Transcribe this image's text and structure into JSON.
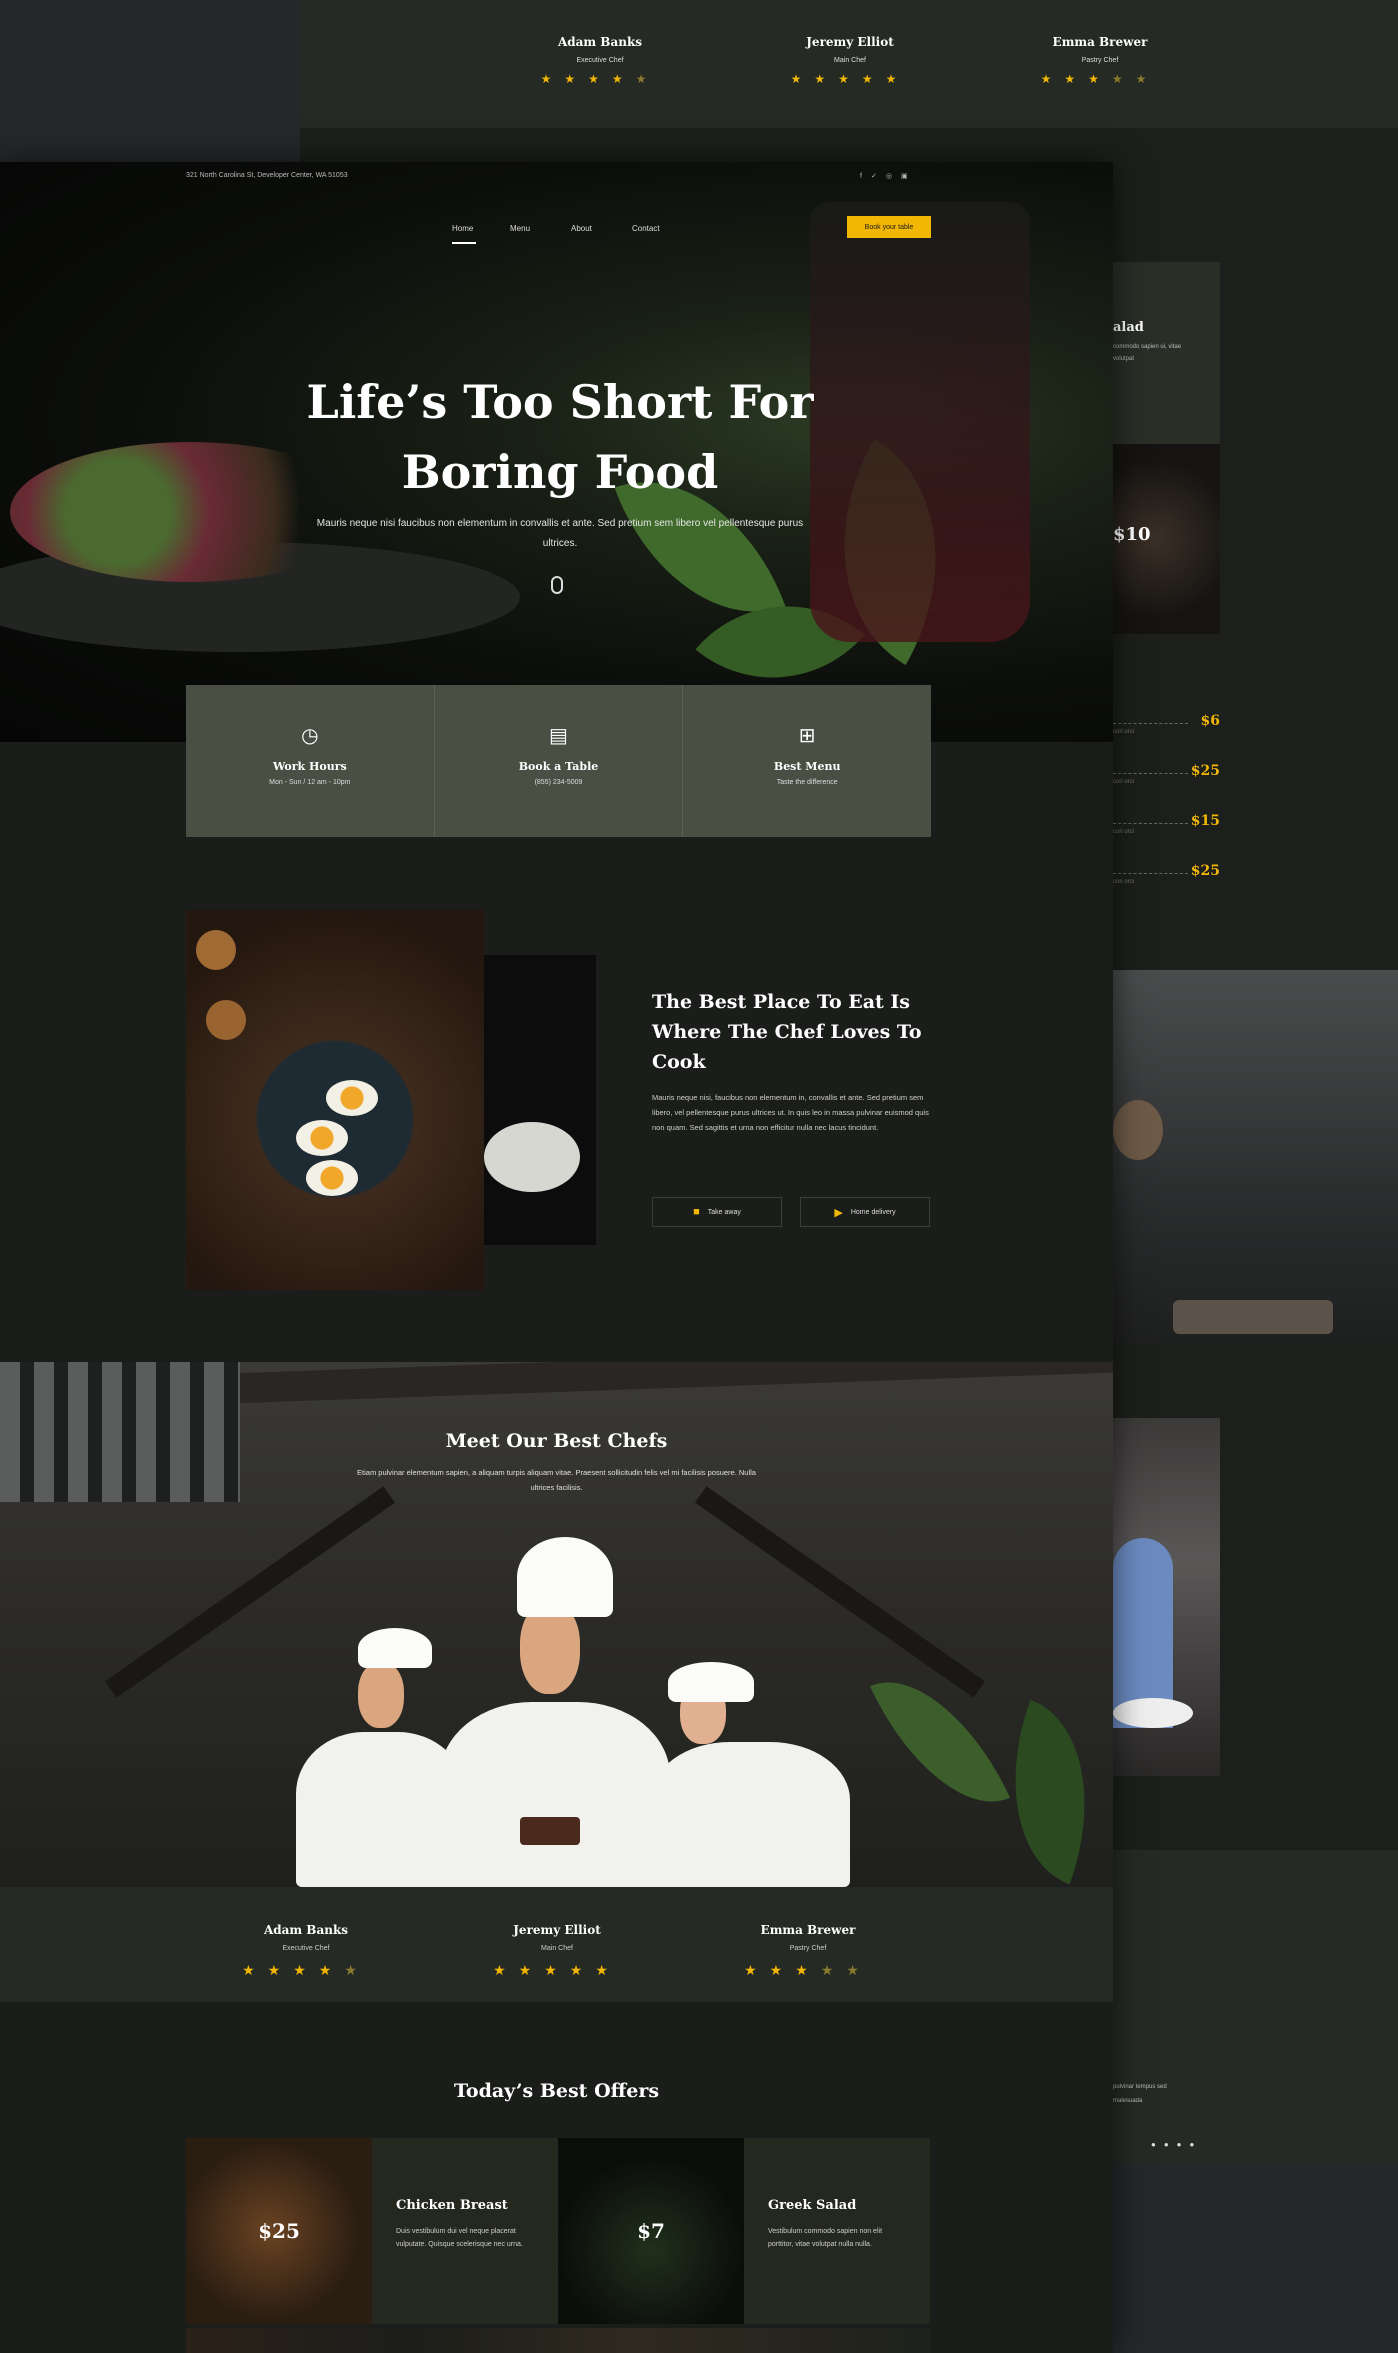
{
  "bg_preview": {
    "chefs": [
      {
        "name": "Adam Banks",
        "role": "Executive Chef",
        "rating": 4
      },
      {
        "name": "Jeremy Elliot",
        "role": "Main Chef",
        "rating": 5
      },
      {
        "name": "Emma Brewer",
        "role": "Pastry Chef",
        "rating": 3
      }
    ],
    "salad_title": "alad",
    "salad_text": "commodo sapien ui, vitae volutpat",
    "price_10": "$10",
    "prices": [
      {
        "price": "$6",
        "sub": "cori orci"
      },
      {
        "price": "$25",
        "sub": "cori orci"
      },
      {
        "price": "$15",
        "sub": "cori orci"
      },
      {
        "price": "$25",
        "sub": "cori orci"
      }
    ],
    "footer_text": "pulvinar tempus sed\nmalesuada"
  },
  "topbar": {
    "address": "321 North Carolina St, Developer Center, WA 51053",
    "social_icons": [
      "facebook-icon",
      "twitter-icon",
      "instagram-icon",
      "youtube-icon"
    ]
  },
  "nav": {
    "items": [
      "Home",
      "Menu",
      "About",
      "Contact"
    ],
    "active": "Home",
    "cta": "Book your table"
  },
  "hero": {
    "title_line1": "Life’s Too Short For",
    "title_line2": "Boring Food",
    "subtitle": "Mauris neque nisi faucibus non elementum in convallis et ante. Sed pretium sem libero vel pellentesque purus ultrices."
  },
  "info": [
    {
      "icon": "clock-icon",
      "title": "Work Hours",
      "sub": "Mon - Sun / 12 am - 10pm"
    },
    {
      "icon": "menu-book-icon",
      "title": "Book a Table",
      "sub": "(855) 234-5009"
    },
    {
      "icon": "clipboard-icon",
      "title": "Best Menu",
      "sub": "Taste the difference"
    }
  ],
  "about": {
    "title": "The Best Place To Eat Is Where The Chef Loves To Cook",
    "text": "Mauris neque nisi, faucibus non elementum in, convallis et ante. Sed pretium sem libero, vel pellentesque purus ultrices ut. In quis leo in massa pulvinar euismod quis non quam. Sed sagittis et urna non efficitur nulla nec lacus tincidunt.",
    "btn1": "Take away",
    "btn2": "Home delivery"
  },
  "chefs_section": {
    "title": "Meet Our Best Chefs",
    "subtitle": "Etiam pulvinar elementum sapien, a aliquam turpis aliquam vitae. Praesent sollicitudin felis vel mi facilisis posuere. Nulla ultrices facilisis."
  },
  "chefs": [
    {
      "name": "Adam Banks",
      "role": "Executive Chef",
      "rating": 4
    },
    {
      "name": "Jeremy Elliot",
      "role": "Main Chef",
      "rating": 5
    },
    {
      "name": "Emma Brewer",
      "role": "Pastry Chef",
      "rating": 3
    }
  ],
  "offers": {
    "title": "Today’s Best Offers",
    "items": [
      {
        "price": "$25",
        "name": "Chicken Breast",
        "desc": "Duis vestibulum dui vel neque placerat vulputate. Quisque scelerisque nec urna."
      },
      {
        "price": "$7",
        "name": "Greek Salad",
        "desc": "Vestibulum commodo sapien non elit porttitor, vitae volutpat nulla nulla."
      }
    ]
  },
  "colors": {
    "accent": "#f2b705",
    "panel": "#4a4f44",
    "background": "#1a1d19"
  }
}
